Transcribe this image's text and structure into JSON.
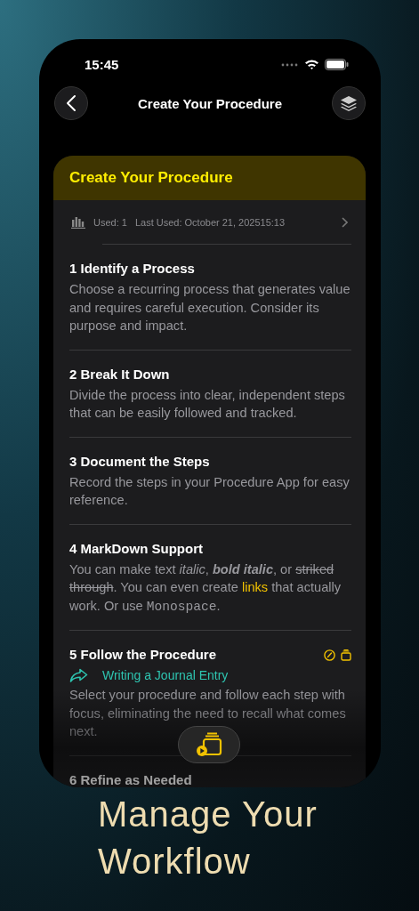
{
  "status_bar": {
    "time": "15:45"
  },
  "nav": {
    "title": "Create Your Procedure"
  },
  "procedure": {
    "title": "Create Your Procedure",
    "used": "Used: 1",
    "last_used": "Last Used: October 21, 202515:13",
    "steps": [
      {
        "kind": "basic",
        "title": "1 Identify a Process",
        "description": "Choose a recurring process that generates value and requires careful execution. Consider its purpose and impact."
      },
      {
        "kind": "basic",
        "title": "2 Break It Down",
        "description": "Divide the process into clear, independent steps that can be easily followed and tracked."
      },
      {
        "kind": "basic",
        "title": "3 Document the Steps",
        "description": "Record the steps in your Procedure App for easy reference."
      },
      {
        "kind": "markdown",
        "title": "4 MarkDown Support",
        "parts": [
          {
            "kind": "plain",
            "text": "You can make text "
          },
          {
            "kind": "italic",
            "text": "italic"
          },
          {
            "kind": "plain",
            "text": ", "
          },
          {
            "kind": "bold_italic",
            "text": "bold italic"
          },
          {
            "kind": "plain",
            "text": ", or "
          },
          {
            "kind": "strike",
            "text": "striked through"
          },
          {
            "kind": "plain",
            "text": ". You can even create "
          },
          {
            "kind": "link",
            "text": "links"
          },
          {
            "kind": "plain",
            "text": " that actually work. Or use "
          },
          {
            "kind": "mono",
            "text": "Monospace"
          },
          {
            "kind": "plain",
            "text": "."
          }
        ]
      },
      {
        "kind": "linked",
        "title": "5 Follow the Procedure",
        "link": "Writing a Journal Entry",
        "description": "Select your procedure and follow each step with focus, eliminating the need to recall what comes next."
      },
      {
        "kind": "basic",
        "title": "6 Refine as Needed"
      }
    ]
  },
  "caption": "Manage Your Workflow"
}
